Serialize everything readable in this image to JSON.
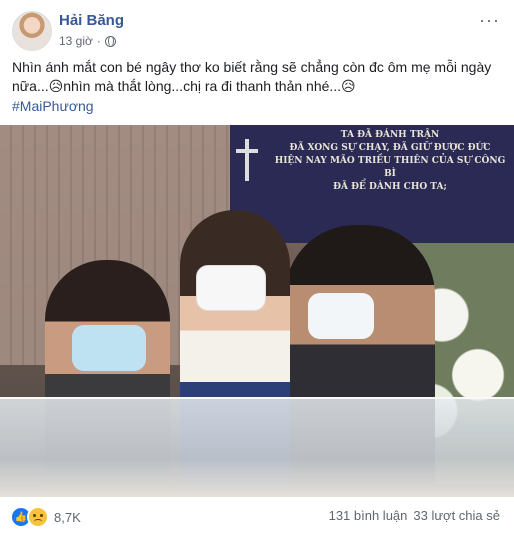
{
  "post": {
    "author": "Hải Băng",
    "time": "13 giờ",
    "more_label": "···",
    "text_line1": "Nhìn ánh mắt con bé ngây thơ ko biết rằng sẽ chẳng còn đc ôm mẹ mỗi ngày",
    "text_line2": "nữa...😥nhìn mà thắt lòng...chị ra đi thanh thản nhé...😥",
    "hashtag": "#MaiPhương"
  },
  "photo": {
    "banner_lines": [
      "TA ĐÃ ĐÁNH TRẬN",
      "ĐÃ XONG SỰ CHẠY, ĐÃ GIỮ ĐƯỢC ĐỨC",
      "HIỆN NAY MÃO TRIỀU THIÊN CỦA SỰ CÔNG BÌ",
      "ĐÃ ĐỂ DÀNH CHO TA;"
    ]
  },
  "footer": {
    "reaction_count": "8,7K",
    "comments": "131 bình luận",
    "shares": "33 lượt chia sẻ"
  },
  "icons": {
    "like": "like-icon",
    "sad": "sad-icon",
    "globe": "globe-icon"
  }
}
